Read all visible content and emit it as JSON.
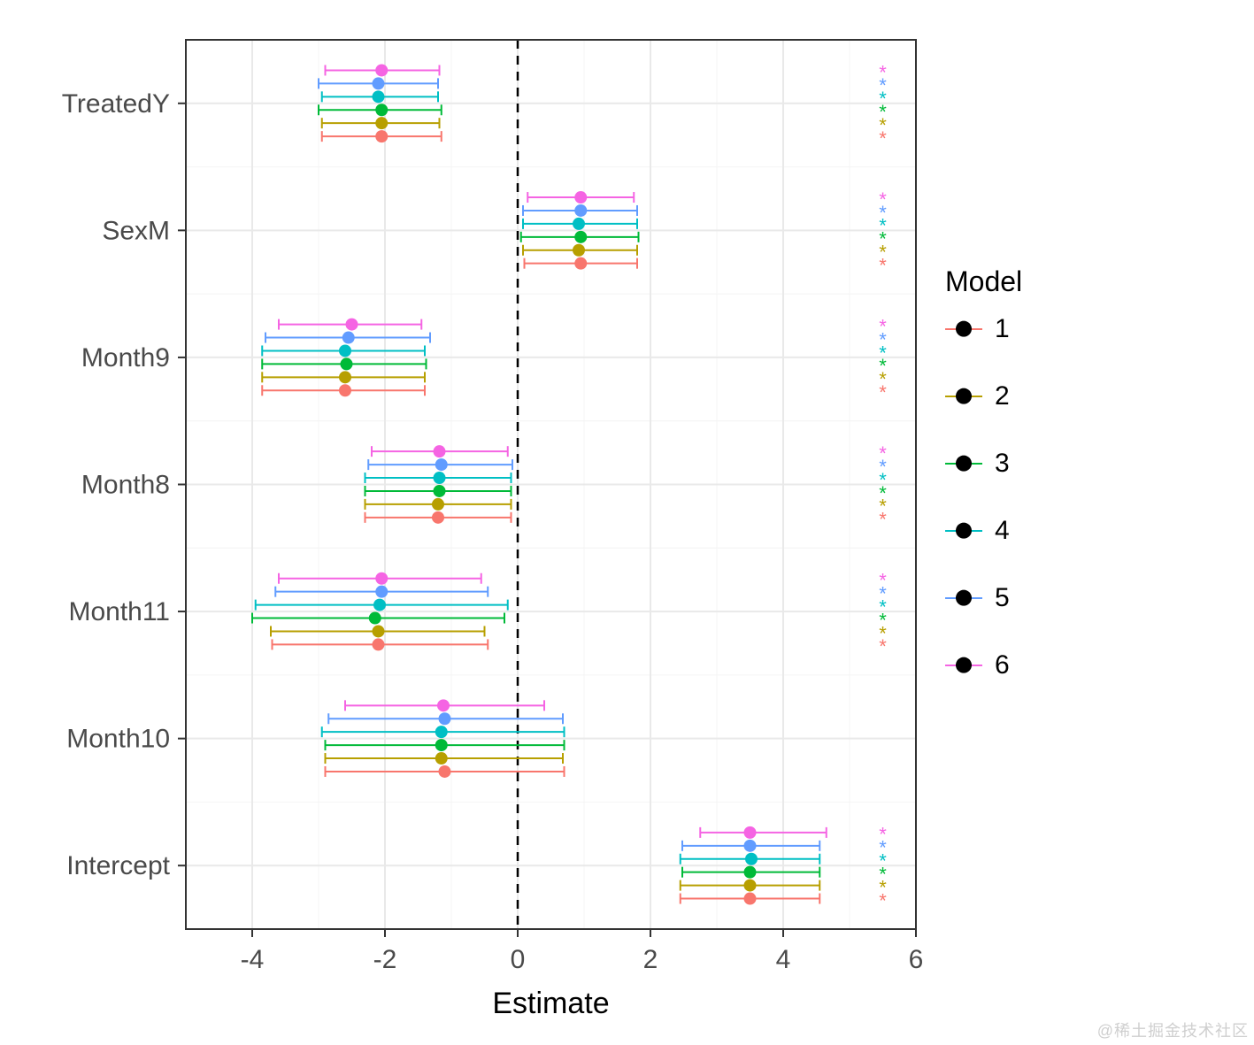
{
  "chart_data": {
    "type": "scatter",
    "title": "",
    "xlabel": "Estimate",
    "ylabel": "",
    "xlim": [
      -5,
      6
    ],
    "x_ticks": [
      -4,
      -2,
      0,
      2,
      4,
      6
    ],
    "reference_x": 0,
    "categories": [
      "TreatedY",
      "SexM",
      "Month9",
      "Month8",
      "Month11",
      "Month10",
      "Intercept"
    ],
    "significance_marker_x": 5.5,
    "series": [
      {
        "name": "1",
        "color": "#F8766D",
        "points": {
          "TreatedY": {
            "estimate": -2.05,
            "low": -2.95,
            "high": -1.15,
            "sig": "*"
          },
          "SexM": {
            "estimate": 0.95,
            "low": 0.1,
            "high": 1.8,
            "sig": "*"
          },
          "Month9": {
            "estimate": -2.6,
            "low": -3.85,
            "high": -1.4,
            "sig": "*"
          },
          "Month8": {
            "estimate": -1.2,
            "low": -2.3,
            "high": -0.1,
            "sig": "*"
          },
          "Month11": {
            "estimate": -2.1,
            "low": -3.7,
            "high": -0.45,
            "sig": "*"
          },
          "Month10": {
            "estimate": -1.1,
            "low": -2.9,
            "high": 0.7,
            "sig": ""
          },
          "Intercept": {
            "estimate": 3.5,
            "low": 2.45,
            "high": 4.55,
            "sig": "*"
          }
        }
      },
      {
        "name": "2",
        "color": "#B79F00",
        "points": {
          "TreatedY": {
            "estimate": -2.05,
            "low": -2.95,
            "high": -1.18,
            "sig": "*"
          },
          "SexM": {
            "estimate": 0.92,
            "low": 0.08,
            "high": 1.8,
            "sig": "*"
          },
          "Month9": {
            "estimate": -2.6,
            "low": -3.85,
            "high": -1.4,
            "sig": "*"
          },
          "Month8": {
            "estimate": -1.2,
            "low": -2.3,
            "high": -0.1,
            "sig": "*"
          },
          "Month11": {
            "estimate": -2.1,
            "low": -3.72,
            "high": -0.5,
            "sig": "*"
          },
          "Month10": {
            "estimate": -1.15,
            "low": -2.9,
            "high": 0.68,
            "sig": ""
          },
          "Intercept": {
            "estimate": 3.5,
            "low": 2.45,
            "high": 4.55,
            "sig": "*"
          }
        }
      },
      {
        "name": "3",
        "color": "#00BA38",
        "points": {
          "TreatedY": {
            "estimate": -2.05,
            "low": -3.0,
            "high": -1.15,
            "sig": "*"
          },
          "SexM": {
            "estimate": 0.95,
            "low": 0.05,
            "high": 1.82,
            "sig": "*"
          },
          "Month9": {
            "estimate": -2.58,
            "low": -3.85,
            "high": -1.38,
            "sig": "*"
          },
          "Month8": {
            "estimate": -1.18,
            "low": -2.3,
            "high": -0.1,
            "sig": "*"
          },
          "Month11": {
            "estimate": -2.15,
            "low": -4.0,
            "high": -0.2,
            "sig": "*"
          },
          "Month10": {
            "estimate": -1.15,
            "low": -2.9,
            "high": 0.7,
            "sig": ""
          },
          "Intercept": {
            "estimate": 3.5,
            "low": 2.48,
            "high": 4.55,
            "sig": "*"
          }
        }
      },
      {
        "name": "4",
        "color": "#00BFC4",
        "points": {
          "TreatedY": {
            "estimate": -2.1,
            "low": -2.95,
            "high": -1.2,
            "sig": "*"
          },
          "SexM": {
            "estimate": 0.92,
            "low": 0.08,
            "high": 1.8,
            "sig": "*"
          },
          "Month9": {
            "estimate": -2.6,
            "low": -3.85,
            "high": -1.4,
            "sig": "*"
          },
          "Month8": {
            "estimate": -1.18,
            "low": -2.3,
            "high": -0.1,
            "sig": "*"
          },
          "Month11": {
            "estimate": -2.08,
            "low": -3.95,
            "high": -0.15,
            "sig": "*"
          },
          "Month10": {
            "estimate": -1.15,
            "low": -2.95,
            "high": 0.7,
            "sig": ""
          },
          "Intercept": {
            "estimate": 3.52,
            "low": 2.45,
            "high": 4.55,
            "sig": "*"
          }
        }
      },
      {
        "name": "5",
        "color": "#619CFF",
        "points": {
          "TreatedY": {
            "estimate": -2.1,
            "low": -3.0,
            "high": -1.2,
            "sig": "*"
          },
          "SexM": {
            "estimate": 0.95,
            "low": 0.08,
            "high": 1.8,
            "sig": "*"
          },
          "Month9": {
            "estimate": -2.55,
            "low": -3.8,
            "high": -1.32,
            "sig": "*"
          },
          "Month8": {
            "estimate": -1.15,
            "low": -2.25,
            "high": -0.08,
            "sig": "*"
          },
          "Month11": {
            "estimate": -2.05,
            "low": -3.65,
            "high": -0.45,
            "sig": "*"
          },
          "Month10": {
            "estimate": -1.1,
            "low": -2.85,
            "high": 0.68,
            "sig": ""
          },
          "Intercept": {
            "estimate": 3.5,
            "low": 2.48,
            "high": 4.55,
            "sig": "*"
          }
        }
      },
      {
        "name": "6",
        "color": "#F564E3",
        "points": {
          "TreatedY": {
            "estimate": -2.05,
            "low": -2.9,
            "high": -1.18,
            "sig": "*"
          },
          "SexM": {
            "estimate": 0.95,
            "low": 0.15,
            "high": 1.75,
            "sig": "*"
          },
          "Month9": {
            "estimate": -2.5,
            "low": -3.6,
            "high": -1.45,
            "sig": "*"
          },
          "Month8": {
            "estimate": -1.18,
            "low": -2.2,
            "high": -0.15,
            "sig": "*"
          },
          "Month11": {
            "estimate": -2.05,
            "low": -3.6,
            "high": -0.55,
            "sig": "*"
          },
          "Month10": {
            "estimate": -1.12,
            "low": -2.6,
            "high": 0.4,
            "sig": ""
          },
          "Intercept": {
            "estimate": 3.5,
            "low": 2.75,
            "high": 4.65,
            "sig": "*"
          }
        }
      }
    ],
    "legend": {
      "title": "Model",
      "entries": [
        "1",
        "2",
        "3",
        "4",
        "5",
        "6"
      ]
    }
  },
  "watermark": "@稀土掘金技术社区"
}
